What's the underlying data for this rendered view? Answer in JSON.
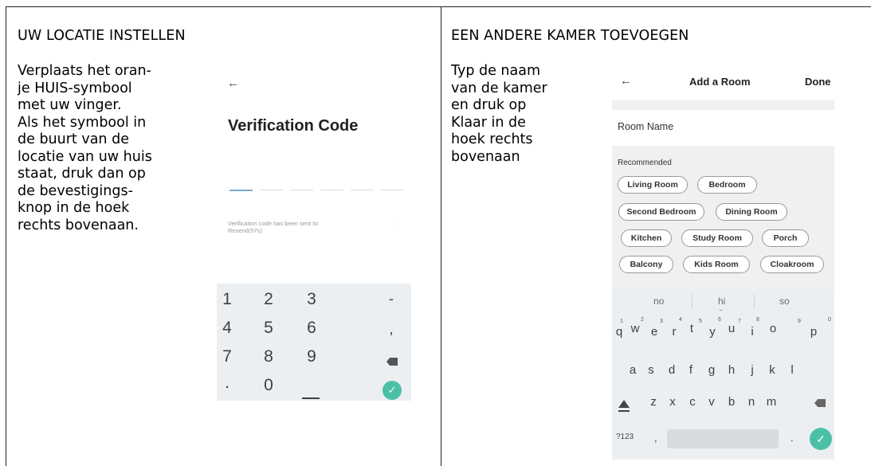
{
  "left_panel": {
    "heading": "UW LOCATIE INSTELLEN",
    "body_lines": [
      "Verplaats het oran-",
      "je HUIS-symbool",
      "met uw vinger.",
      "Als het symbool in",
      "de buurt van de",
      "locatie van uw huis",
      "staat, druk dan op",
      "de bevestigings-",
      "knop in de hoek",
      "rechts bovenaan."
    ],
    "phone": {
      "back_glyph": "←",
      "title": "Verification Code",
      "sent_text": "Verification code has been sent to:",
      "resend_text": "Resend(57s)",
      "trailing_dot": ".",
      "numpad_rows": [
        [
          "1",
          "2",
          "3",
          "-"
        ],
        [
          "4",
          "5",
          "6",
          ","
        ],
        [
          "7",
          "8",
          "9"
        ],
        [
          ".",
          "0"
        ]
      ],
      "ok_glyph": "✓",
      "accent_color": "#4cc0a7"
    }
  },
  "right_panel": {
    "heading": "EEN ANDERE KAMER TOEVOEGEN",
    "body_lines": [
      "Typ de naam",
      "van de kamer",
      "en druk op",
      "Klaar in de",
      "hoek rechts",
      "bovenaan"
    ],
    "phone": {
      "back_glyph": "←",
      "title": "Add a Room",
      "done_label": "Done",
      "room_name_label": "Room Name",
      "recommended_label": "Recommended",
      "chips": [
        "Living Room",
        "Bedroom",
        "Second Bedroom",
        "Dining Room",
        "Kitchen",
        "Study Room",
        "Porch",
        "Balcony",
        "Kids Room",
        "Cloakroom"
      ],
      "suggestions": [
        "no",
        "hi",
        "so"
      ],
      "suggestion_dots": "...",
      "row1": [
        "q",
        "w",
        "e",
        "r",
        "t",
        "y",
        "u",
        "i",
        "o",
        "p"
      ],
      "row1_hints": [
        "1",
        "2",
        "3",
        "4",
        "5",
        "6",
        "7",
        "8",
        "9",
        "0"
      ],
      "row2": [
        "a",
        "s",
        "d",
        "f",
        "g",
        "h",
        "j",
        "k",
        "l"
      ],
      "row3": [
        "z",
        "x",
        "c",
        "v",
        "b",
        "n",
        "m"
      ],
      "symbols_label": "?123",
      "comma": ",",
      "period": ".",
      "ok_glyph": "✓"
    }
  }
}
